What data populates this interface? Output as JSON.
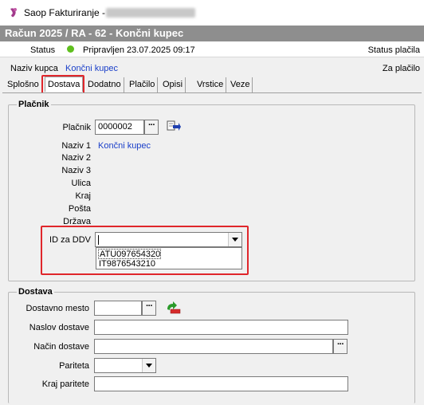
{
  "window": {
    "title": "Saop Fakturiranje - "
  },
  "document": {
    "header": "Račun  2025 / RA - 62 - Končni kupec"
  },
  "status": {
    "label": "Status",
    "text": "Pripravljen 23.07.2025 09:17",
    "right": "Status plačila",
    "dot_color": "#5fbf1e"
  },
  "buyer": {
    "label": "Naziv kupca",
    "value": "Končni kupec",
    "right": "Za plačilo"
  },
  "tabs": [
    {
      "label": "Splošno",
      "active": false
    },
    {
      "label": "Dostava",
      "active": true
    },
    {
      "label": "Dodatno",
      "active": false
    },
    {
      "label": "Plačilo",
      "active": false
    },
    {
      "label": "Opisi",
      "active": false
    },
    {
      "label": "Vrstice",
      "active": false
    },
    {
      "label": "Veze",
      "active": false
    }
  ],
  "placnik": {
    "group_title": "Plačnik",
    "payer_label": "Plačnik",
    "payer_value": "0000002",
    "naziv1_label": "Naziv 1",
    "naziv1_value": "Končni kupec",
    "naziv2_label": "Naziv 2",
    "naziv3_label": "Naziv 3",
    "ulica_label": "Ulica",
    "kraj_label": "Kraj",
    "posta_label": "Pošta",
    "drzava_label": "Država",
    "ddv_label": "ID za DDV",
    "ddv_value": "",
    "ddv_options": [
      "ATU097654320",
      "IT9876543210"
    ]
  },
  "dostava": {
    "group_title": "Dostava",
    "mesto_label": "Dostavno mesto",
    "naslov_label": "Naslov dostave",
    "nacin_label": "Način dostave",
    "pariteta_label": "Pariteta",
    "kraj_paritete_label": "Kraj paritete"
  },
  "highlight_color": "#e0262b"
}
